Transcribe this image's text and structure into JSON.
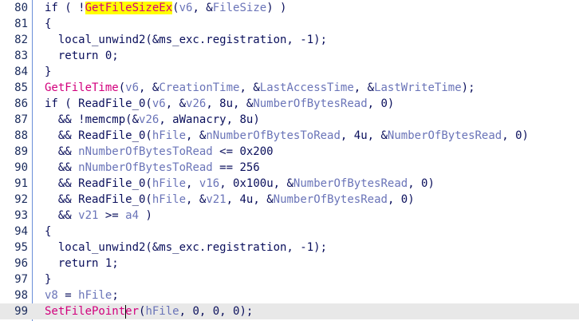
{
  "colors": {
    "plain": "#0a0f5c",
    "function": "#d2007d",
    "variable": "#6a74b8",
    "highlight": "#ffff00",
    "gutter_border": "#6b8fd8",
    "current_line": "#e8e8e8"
  },
  "lines": [
    {
      "n": "80",
      "indent": "",
      "tokens": [
        [
          "p",
          "if ( !"
        ],
        [
          "h",
          "GetFileSizeEx"
        ],
        [
          "p",
          "("
        ],
        [
          "v",
          "v6"
        ],
        [
          "p",
          ", &"
        ],
        [
          "v",
          "FileSize"
        ],
        [
          "p",
          ") )"
        ]
      ]
    },
    {
      "n": "81",
      "indent": "",
      "tokens": [
        [
          "p",
          "{"
        ]
      ]
    },
    {
      "n": "82",
      "indent": "  ",
      "tokens": [
        [
          "p",
          "local_unwind2(&ms_exc.registration, -1);"
        ]
      ]
    },
    {
      "n": "83",
      "indent": "  ",
      "tokens": [
        [
          "p",
          "return 0;"
        ]
      ]
    },
    {
      "n": "84",
      "indent": "",
      "tokens": [
        [
          "p",
          "}"
        ]
      ]
    },
    {
      "n": "85",
      "indent": "",
      "tokens": [
        [
          "f",
          "GetFileTime"
        ],
        [
          "p",
          "("
        ],
        [
          "v",
          "v6"
        ],
        [
          "p",
          ", &"
        ],
        [
          "v",
          "CreationTime"
        ],
        [
          "p",
          ", &"
        ],
        [
          "v",
          "LastAccessTime"
        ],
        [
          "p",
          ", &"
        ],
        [
          "v",
          "LastWriteTime"
        ],
        [
          "p",
          ");"
        ]
      ]
    },
    {
      "n": "86",
      "indent": "",
      "tokens": [
        [
          "p",
          "if ( ReadFile_0("
        ],
        [
          "v",
          "v6"
        ],
        [
          "p",
          ", &"
        ],
        [
          "v",
          "v26"
        ],
        [
          "p",
          ", 8u, &"
        ],
        [
          "v",
          "NumberOfBytesRead"
        ],
        [
          "p",
          ", 0)"
        ]
      ]
    },
    {
      "n": "87",
      "indent": "  ",
      "tokens": [
        [
          "p",
          "&& !memcmp(&"
        ],
        [
          "v",
          "v26"
        ],
        [
          "p",
          ", aWanacry, 8u)"
        ]
      ]
    },
    {
      "n": "88",
      "indent": "  ",
      "tokens": [
        [
          "p",
          "&& ReadFile_0("
        ],
        [
          "v",
          "hFile"
        ],
        [
          "p",
          ", &"
        ],
        [
          "v",
          "nNumberOfBytesToRead"
        ],
        [
          "p",
          ", 4u, &"
        ],
        [
          "v",
          "NumberOfBytesRead"
        ],
        [
          "p",
          ", 0)"
        ]
      ]
    },
    {
      "n": "89",
      "indent": "  ",
      "tokens": [
        [
          "p",
          "&& "
        ],
        [
          "v",
          "nNumberOfBytesToRead"
        ],
        [
          "p",
          " <= 0x200"
        ]
      ]
    },
    {
      "n": "90",
      "indent": "  ",
      "tokens": [
        [
          "p",
          "&& "
        ],
        [
          "v",
          "nNumberOfBytesToRead"
        ],
        [
          "p",
          " == 256"
        ]
      ]
    },
    {
      "n": "91",
      "indent": "  ",
      "tokens": [
        [
          "p",
          "&& ReadFile_0("
        ],
        [
          "v",
          "hFile"
        ],
        [
          "p",
          ", "
        ],
        [
          "v",
          "v16"
        ],
        [
          "p",
          ", 0x100u, &"
        ],
        [
          "v",
          "NumberOfBytesRead"
        ],
        [
          "p",
          ", 0)"
        ]
      ]
    },
    {
      "n": "92",
      "indent": "  ",
      "tokens": [
        [
          "p",
          "&& ReadFile_0("
        ],
        [
          "v",
          "hFile"
        ],
        [
          "p",
          ", &"
        ],
        [
          "v",
          "v21"
        ],
        [
          "p",
          ", 4u, &"
        ],
        [
          "v",
          "NumberOfBytesRead"
        ],
        [
          "p",
          ", 0)"
        ]
      ]
    },
    {
      "n": "93",
      "indent": "  ",
      "tokens": [
        [
          "p",
          "&& "
        ],
        [
          "v",
          "v21"
        ],
        [
          "p",
          " >= "
        ],
        [
          "v",
          "a4"
        ],
        [
          "p",
          " )"
        ]
      ]
    },
    {
      "n": "94",
      "indent": "",
      "tokens": [
        [
          "p",
          "{"
        ]
      ]
    },
    {
      "n": "95",
      "indent": "  ",
      "tokens": [
        [
          "p",
          "local_unwind2(&ms_exc.registration, -1);"
        ]
      ]
    },
    {
      "n": "96",
      "indent": "  ",
      "tokens": [
        [
          "p",
          "return 1;"
        ]
      ]
    },
    {
      "n": "97",
      "indent": "",
      "tokens": [
        [
          "p",
          "}"
        ]
      ]
    },
    {
      "n": "98",
      "indent": "",
      "tokens": [
        [
          "v",
          "v8"
        ],
        [
          "p",
          " = "
        ],
        [
          "v",
          "hFile"
        ],
        [
          "p",
          ";"
        ]
      ]
    },
    {
      "n": "99",
      "indent": "",
      "current": true,
      "tokens": [
        [
          "f",
          "SetFilePointer"
        ],
        [
          "p",
          "("
        ],
        [
          "v",
          "hFile"
        ],
        [
          "p",
          ", 0, 0, 0);"
        ]
      ]
    }
  ]
}
